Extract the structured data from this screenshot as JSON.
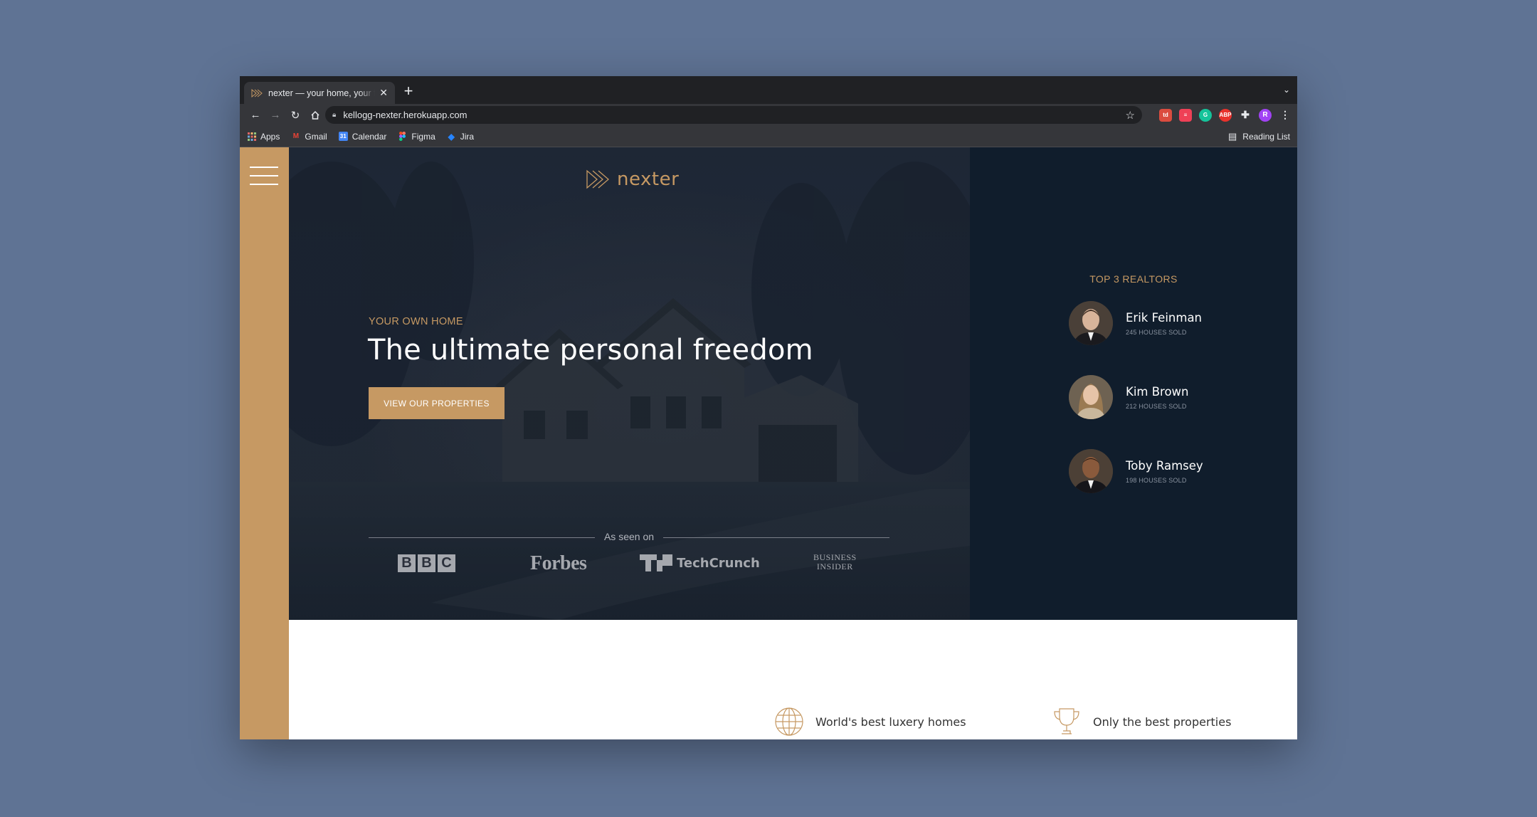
{
  "browser": {
    "tab_title": "nexter — your home, your freedom",
    "new_tab_icon": "plus-icon",
    "url": "kellogg-nexter.herokuapp.com",
    "bookmarks": [
      {
        "label": "Apps",
        "icon": "apps-grid-icon"
      },
      {
        "label": "Gmail",
        "icon": "gmail-icon"
      },
      {
        "label": "Calendar",
        "icon": "calendar-icon"
      },
      {
        "label": "Figma",
        "icon": "figma-icon"
      },
      {
        "label": "Jira",
        "icon": "jira-icon"
      }
    ],
    "reading_list": "Reading List",
    "profile_initial": "R",
    "extensions": [
      "todoist",
      "pocket",
      "grammarly",
      "adblock-plus",
      "extensions"
    ]
  },
  "site": {
    "logo_text": "nexter",
    "hero": {
      "eyebrow": "YOUR OWN HOME",
      "headline": "The ultimate personal freedom",
      "cta": "VIEW OUR PROPERTIES",
      "seen_on": "As seen on",
      "press": {
        "bbc": [
          "B",
          "B",
          "C"
        ],
        "forbes": "Forbes",
        "techcrunch": "TechCrunch",
        "bi_line1": "BUSINESS",
        "bi_line2": "INSIDER"
      }
    },
    "realtors": {
      "title": "TOP 3 REALTORS",
      "items": [
        {
          "name": "Erik Feinman",
          "sold": "245 HOUSES SOLD"
        },
        {
          "name": "Kim Brown",
          "sold": "212 HOUSES SOLD"
        },
        {
          "name": "Toby Ramsey",
          "sold": "198 HOUSES SOLD"
        }
      ]
    },
    "features": [
      {
        "label": "World's best luxery homes",
        "icon": "globe-icon"
      },
      {
        "label": "Only the best properties",
        "icon": "trophy-icon"
      }
    ]
  },
  "colors": {
    "accent": "#c69963",
    "dark": "#101d2c",
    "backdrop": "#5f7394"
  }
}
